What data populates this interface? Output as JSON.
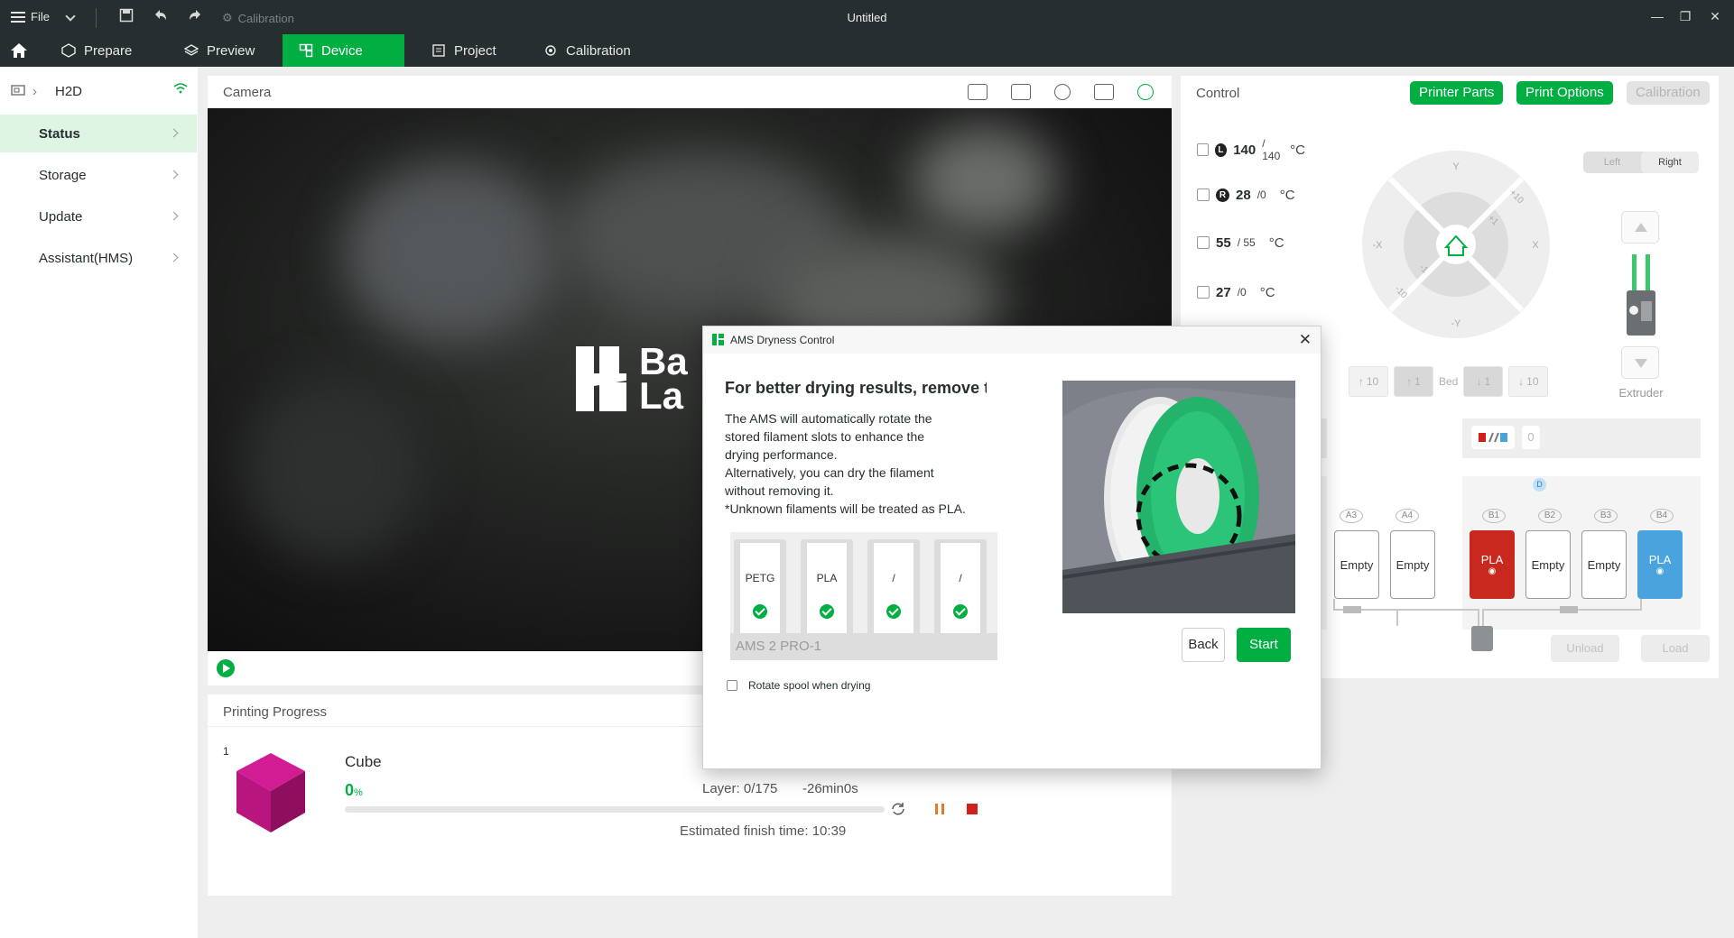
{
  "titlebar": {
    "file_label": "File",
    "calibration_label": "Calibration",
    "window_title": "Untitled"
  },
  "tabs": [
    {
      "label": "Prepare"
    },
    {
      "label": "Preview"
    },
    {
      "label": "Device"
    },
    {
      "label": "Project"
    },
    {
      "label": "Calibration"
    }
  ],
  "sidebar": {
    "device_name": "H2D",
    "items": [
      {
        "label": "Status"
      },
      {
        "label": "Storage"
      },
      {
        "label": "Update"
      },
      {
        "label": "Assistant(HMS)"
      }
    ]
  },
  "camera": {
    "title": "Camera",
    "brand_line1": "Ba",
    "brand_line2": "La"
  },
  "progress": {
    "title": "Printing Progress",
    "plate": "1",
    "task_name": "Cube",
    "percent": "0",
    "percent_unit": "%",
    "fraction": 0,
    "layer": "Layer: 0/175",
    "remaining": "-26min0s",
    "finish_time": "Estimated finish time: 10:39"
  },
  "control": {
    "title": "Control",
    "buttons": {
      "printer_parts": "Printer Parts",
      "print_options": "Print Options",
      "calibration": "Calibration"
    },
    "temps": {
      "left_nozzle": {
        "badge": "L",
        "current": "140",
        "target": "/ 140",
        "unit": "°C"
      },
      "right_nozzle": {
        "badge": "R",
        "current": "28",
        "target": "/0",
        "unit": "°C"
      },
      "bed": {
        "current": "55",
        "target": "/ 55",
        "unit": "°C"
      },
      "chamber": {
        "current": "27",
        "target": "/0",
        "unit": "°C"
      }
    },
    "jog": {
      "y_pos": "Y",
      "y_neg": "-Y",
      "x_pos": "X",
      "x_neg": "-X",
      "plus10": "+10",
      "plus1": "+1",
      "minus1": "-1",
      "minus10": "-10"
    },
    "bed_controls": {
      "up10": "10",
      "up1": "1",
      "label": "Bed",
      "down1": "1",
      "down10": "10"
    },
    "extruder": {
      "left": "Left",
      "right": "Right",
      "label": "Extruder"
    },
    "ams": {
      "ext_count": "0",
      "left_slots": [
        {
          "id": "A3",
          "label": "Empty"
        },
        {
          "id": "A4",
          "label": "Empty"
        }
      ],
      "right_slots": [
        {
          "id": "B1",
          "label": "PLA",
          "color": "#c8281e"
        },
        {
          "id": "B2",
          "label": "Empty"
        },
        {
          "id": "B3",
          "label": "Empty"
        },
        {
          "id": "B4",
          "label": "PLA",
          "color": "#4aa3dd"
        }
      ],
      "unload": "Unload",
      "load": "Load",
      "humidity_badge": "D"
    }
  },
  "dialog": {
    "title": "AMS Dryness Control",
    "heading": "For better drying results, remove the",
    "body": [
      "The AMS will automatically rotate the",
      "stored filament slots to enhance the",
      "drying performance.",
      "Alternatively, you can dry the filament",
      "without removing it.",
      "*Unknown filaments will be treated as PLA."
    ],
    "slots": [
      {
        "label": "PETG"
      },
      {
        "label": "PLA"
      },
      {
        "label": "/"
      },
      {
        "label": "/"
      }
    ],
    "ams_name": "AMS 2 PRO-1",
    "checkbox_label": "Rotate spool when drying",
    "back": "Back",
    "start": "Start"
  },
  "colors": {
    "accent": "#00ae42",
    "dark_bar": "#262e30",
    "cube": "#c21885"
  }
}
